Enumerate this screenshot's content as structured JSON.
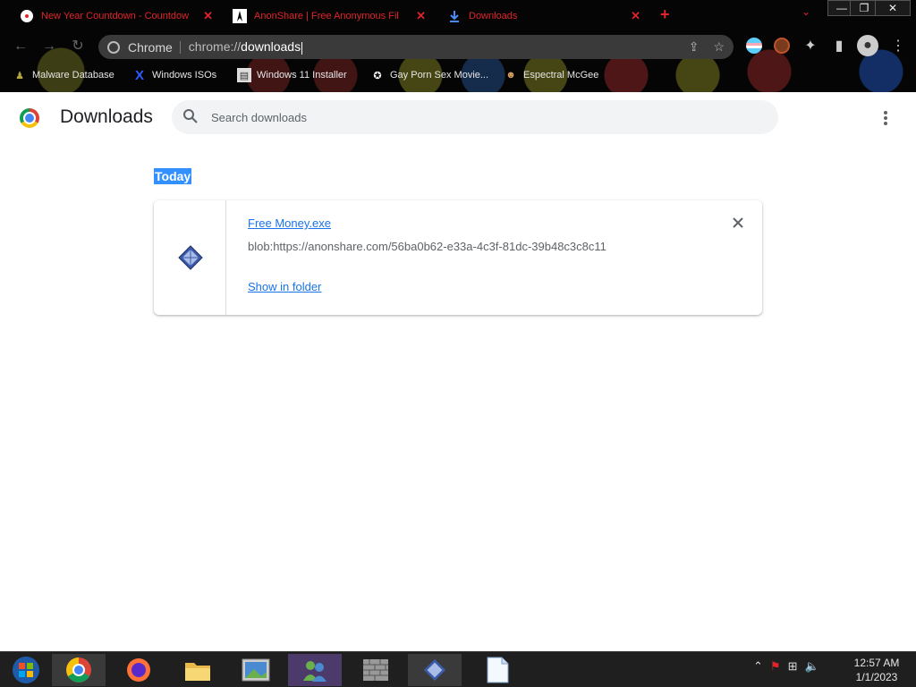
{
  "tabs": [
    {
      "title": "New Year Countdown - Countdow",
      "icon": "clock-face-icon"
    },
    {
      "title": "AnonShare | Free Anonymous Fil",
      "icon": "anonshare-icon"
    },
    {
      "title": "Downloads",
      "icon": "download-arrow-icon"
    }
  ],
  "window_controls": {
    "minimize": "—",
    "restore": "❐",
    "close": "✕"
  },
  "toolbar": {
    "chip_label": "Chrome",
    "url_prefix": "chrome://",
    "url_host": "downloads"
  },
  "bookmarks": [
    {
      "label": "Malware Database",
      "icon": "person-icon"
    },
    {
      "label": "Windows ISOs",
      "icon": "x-icon"
    },
    {
      "label": "Windows 11 Installer",
      "icon": "page-icon"
    },
    {
      "label": "Gay Porn Sex Movie...",
      "icon": "site-icon"
    },
    {
      "label": "Espectral McGee",
      "icon": "site-icon"
    }
  ],
  "downloads_page": {
    "title": "Downloads",
    "search_placeholder": "Search downloads",
    "date_header": "Today",
    "item": {
      "file_name": "Free Money.exe",
      "source_url": "blob:https://anonshare.com/56ba0b62-e33a-4c3f-81dc-39b48c3c8c11",
      "show_in_folder": "Show in folder"
    }
  },
  "taskbar": {
    "time": "12:57 AM",
    "date": "1/1/2023"
  },
  "colors": {
    "tab_text": "#e0242a",
    "link": "#1a73e8",
    "selection": "#3390ff"
  }
}
